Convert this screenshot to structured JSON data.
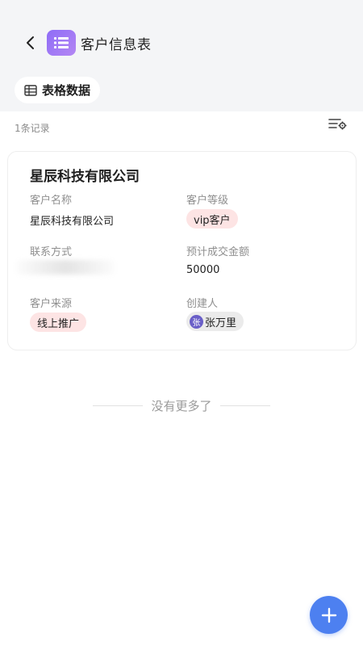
{
  "header": {
    "title": "客户信息表",
    "app_icon": "list-icon",
    "accent": "#9a78f5"
  },
  "view_tab": {
    "icon": "table-icon",
    "label": "表格数据"
  },
  "records": {
    "count_text": "1条记录",
    "settings_icon": "list-settings-icon"
  },
  "card": {
    "title": "星辰科技有限公司",
    "fields": {
      "customer_name": {
        "label": "客户名称",
        "value": "星辰科技有限公司"
      },
      "customer_level": {
        "label": "客户等级",
        "value": "vip客户"
      },
      "contact": {
        "label": "联系方式"
      },
      "expected_amount": {
        "label": "预计成交金额",
        "value": "50000"
      },
      "source": {
        "label": "客户来源",
        "value": "线上推广"
      },
      "creator": {
        "label": "创建人",
        "avatar_text": "张",
        "value": "张万里"
      }
    }
  },
  "footer": {
    "end_text": "没有更多了"
  },
  "fab": {
    "icon": "plus-icon",
    "color": "#4d80f0"
  }
}
